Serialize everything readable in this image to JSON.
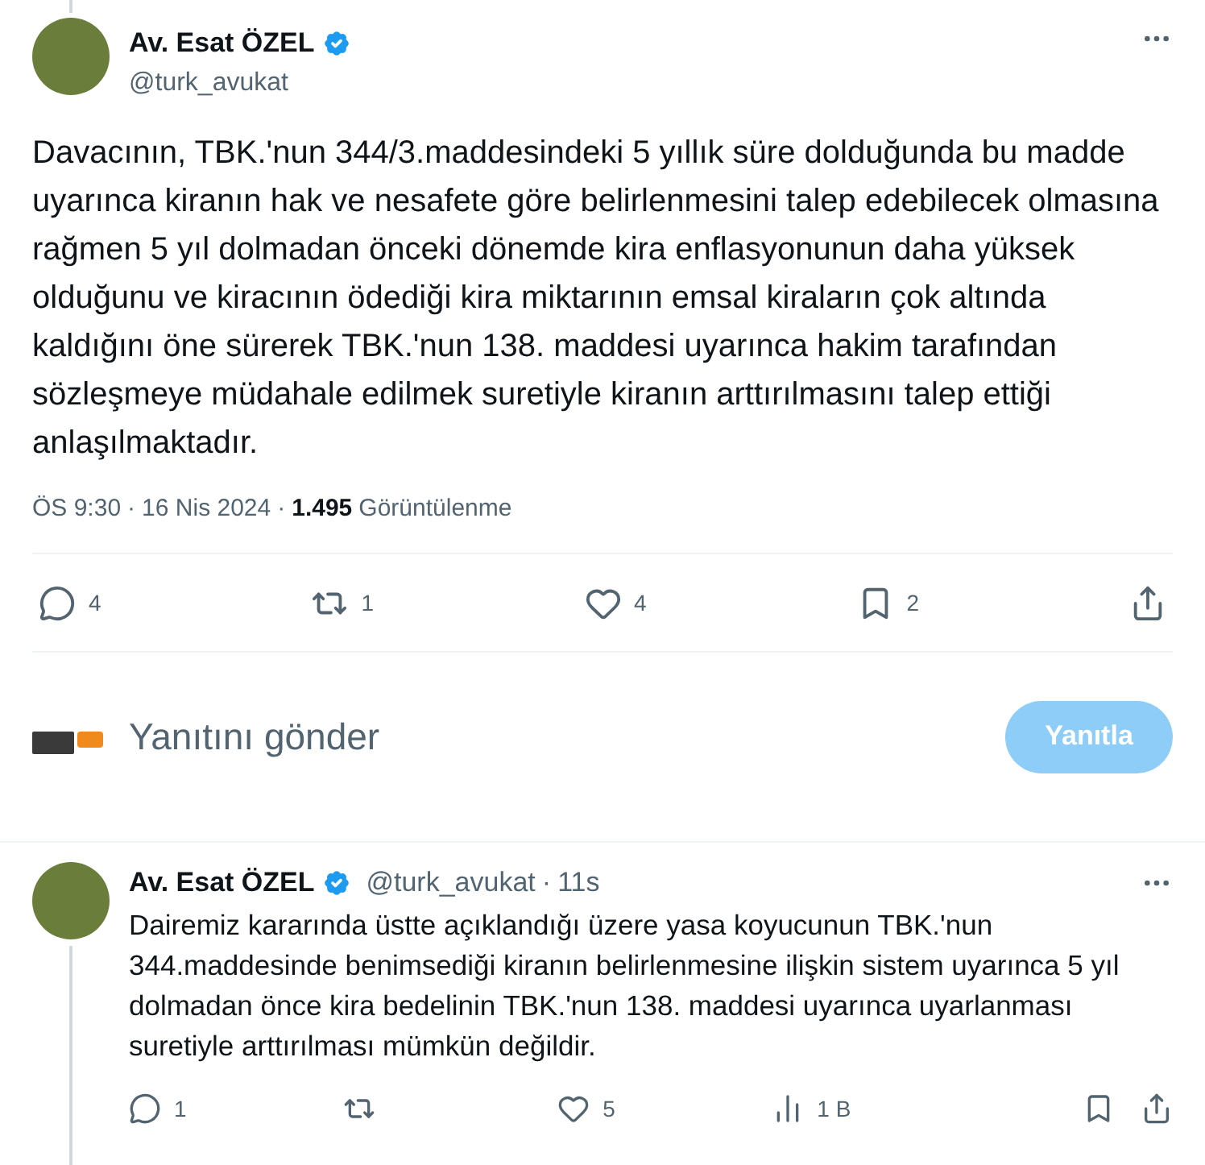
{
  "main_tweet": {
    "author": {
      "name": "Av. Esat ÖZEL",
      "handle": "@turk_avukat",
      "verified": true
    },
    "text": "Davacının, TBK.'nun 344/3.maddesindeki 5 yıllık süre dolduğunda bu madde uyarınca kiranın hak ve nesafete göre belirlenmesini talep edebilecek olmasına rağmen 5 yıl dolmadan önceki dönemde kira enflasyonunun daha yüksek olduğunu ve kiracının ödediği kira miktarının emsal kiraların çok altında kaldığını öne sürerek TBK.'nun 138. maddesi uyarınca hakim tarafından sözleşmeye müdahale edilmek suretiyle kiranın arttırılmasını talep ettiği anlaşılmaktadır.",
    "time": "ÖS 9:30",
    "separator_1": "·",
    "date": "16 Nis 2024",
    "separator_2": "·",
    "views": "1.495",
    "views_label": "Görüntülenme",
    "actions": [
      {
        "kind": "reply",
        "count": "4"
      },
      {
        "kind": "retweet",
        "count": "1"
      },
      {
        "kind": "like",
        "count": "4"
      },
      {
        "kind": "bookmark",
        "count": "2"
      },
      {
        "kind": "share"
      }
    ]
  },
  "reply_box": {
    "placeholder": "Yanıtını gönder",
    "button": "Yanıtla",
    "disabled": true
  },
  "reply_tweet": {
    "author": {
      "name": "Av. Esat ÖZEL",
      "handle": "@turk_avukat",
      "verified": true
    },
    "separator": "·",
    "age": "11s",
    "text": "Dairemiz kararında üstte açıklandığı üzere yasa koyucunun TBK.'nun 344.maddesinde benimsediği kiranın belirlenmesine ilişkin sistem uyarınca 5 yıl dolmadan önce kira bedelinin TBK.'nun 138. maddesi uyarınca uyarlanması suretiyle arttırılması mümkün değildir.",
    "actions": [
      {
        "kind": "reply",
        "count": "1"
      },
      {
        "kind": "retweet"
      },
      {
        "kind": "like",
        "count": "5"
      },
      {
        "kind": "views",
        "count": "1 B"
      },
      {
        "kind": "bookmark"
      },
      {
        "kind": "share"
      }
    ]
  }
}
